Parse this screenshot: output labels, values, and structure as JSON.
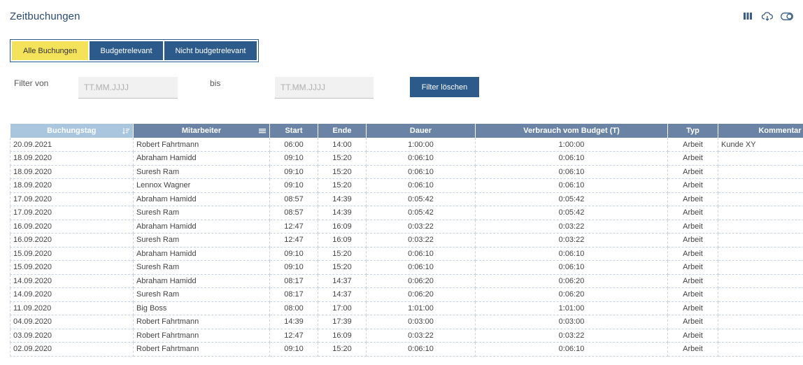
{
  "page": {
    "title": "Zeitbuchungen"
  },
  "toolbar": {
    "icons": [
      "columns-icon",
      "cloud-download-icon",
      "toggle-icon"
    ]
  },
  "tabs": [
    {
      "label": "Alle Buchungen",
      "active": true
    },
    {
      "label": "Budgetrelevant",
      "active": false
    },
    {
      "label": "Nicht budgetrelevant",
      "active": false
    }
  ],
  "filter": {
    "from_label": "Filter von",
    "from_placeholder": "TT.MM.JJJJ",
    "to_label": "bis",
    "to_placeholder": "TT.MM.JJJJ",
    "clear_label": "Filter löschen"
  },
  "colors": {
    "primary": "#2c5a8a",
    "active_tab": "#f4e35a",
    "header": "#6b84a6",
    "sorted_header": "#a9c6de"
  },
  "table": {
    "headers": [
      "Buchungstag",
      "Mitarbeiter",
      "Start",
      "Ende",
      "Dauer",
      "Verbrauch vom Budget (T)",
      "Typ",
      "Kommentar"
    ],
    "rows": [
      [
        "20.09.2021",
        "Robert Fahrtmann",
        "06:00",
        "14:00",
        "1:00:00",
        "1:00:00",
        "Arbeit",
        "Kunde XY"
      ],
      [
        "18.09.2020",
        "Abraham Hamidd",
        "09:10",
        "15:20",
        "0:06:10",
        "0:06:10",
        "Arbeit",
        ""
      ],
      [
        "18.09.2020",
        "Suresh Ram",
        "09:10",
        "15:20",
        "0:06:10",
        "0:06:10",
        "Arbeit",
        ""
      ],
      [
        "18.09.2020",
        "Lennox Wagner",
        "09:10",
        "15:20",
        "0:06:10",
        "0:06:10",
        "Arbeit",
        ""
      ],
      [
        "17.09.2020",
        "Abraham Hamidd",
        "08:57",
        "14:39",
        "0:05:42",
        "0:05:42",
        "Arbeit",
        ""
      ],
      [
        "17.09.2020",
        "Suresh Ram",
        "08:57",
        "14:39",
        "0:05:42",
        "0:05:42",
        "Arbeit",
        ""
      ],
      [
        "16.09.2020",
        "Abraham Hamidd",
        "12:47",
        "16:09",
        "0:03:22",
        "0:03:22",
        "Arbeit",
        ""
      ],
      [
        "16.09.2020",
        "Suresh Ram",
        "12:47",
        "16:09",
        "0:03:22",
        "0:03:22",
        "Arbeit",
        ""
      ],
      [
        "15.09.2020",
        "Abraham Hamidd",
        "09:10",
        "15:20",
        "0:06:10",
        "0:06:10",
        "Arbeit",
        ""
      ],
      [
        "15.09.2020",
        "Suresh Ram",
        "09:10",
        "15:20",
        "0:06:10",
        "0:06:10",
        "Arbeit",
        ""
      ],
      [
        "14.09.2020",
        "Abraham Hamidd",
        "08:17",
        "14:37",
        "0:06:20",
        "0:06:20",
        "Arbeit",
        ""
      ],
      [
        "14.09.2020",
        "Suresh Ram",
        "08:17",
        "14:37",
        "0:06:20",
        "0:06:20",
        "Arbeit",
        ""
      ],
      [
        "11.09.2020",
        "Big Boss",
        "08:00",
        "17:00",
        "1:01:00",
        "1:01:00",
        "Arbeit",
        ""
      ],
      [
        "04.09.2020",
        "Robert Fahrtmann",
        "14:39",
        "17:39",
        "0:03:00",
        "0:03:00",
        "Arbeit",
        ""
      ],
      [
        "03.09.2020",
        "Robert Fahrtmann",
        "12:47",
        "16:09",
        "0:03:22",
        "0:03:22",
        "Arbeit",
        ""
      ],
      [
        "02.09.2020",
        "Robert Fahrtmann",
        "09:10",
        "15:20",
        "0:06:10",
        "0:06:10",
        "Arbeit",
        ""
      ]
    ]
  }
}
